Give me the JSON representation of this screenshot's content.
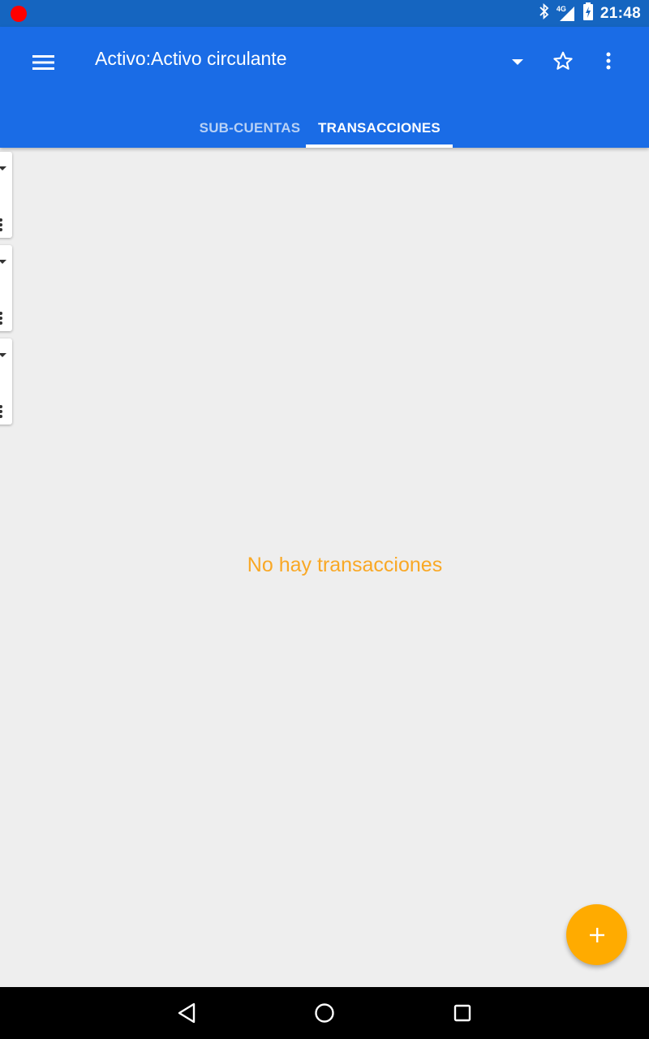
{
  "status_bar": {
    "time": "21:48",
    "network": "4G",
    "icons": [
      "record-icon",
      "bluetooth-icon",
      "signal-icon",
      "battery-charging-icon"
    ]
  },
  "app_bar": {
    "title": "Activo:Activo circulante",
    "icons": [
      "menu-icon",
      "dropdown-arrow-icon",
      "star-outline-icon",
      "more-vert-icon"
    ]
  },
  "tabs": [
    {
      "label": "SUB-CUENTAS",
      "selected": false
    },
    {
      "label": "TRANSACCIONES",
      "selected": true
    }
  ],
  "empty_state": {
    "message": "No hay transacciones"
  },
  "fab": {
    "icon": "add-icon"
  },
  "nav_bar": {
    "icons": [
      "back-icon",
      "home-icon",
      "recents-icon"
    ]
  },
  "colors": {
    "status_bar": "#1565c0",
    "app_bar": "#1a6ce6",
    "accent": "#ffab00",
    "empty_text": "#f9a825",
    "background": "#eeeeee"
  }
}
